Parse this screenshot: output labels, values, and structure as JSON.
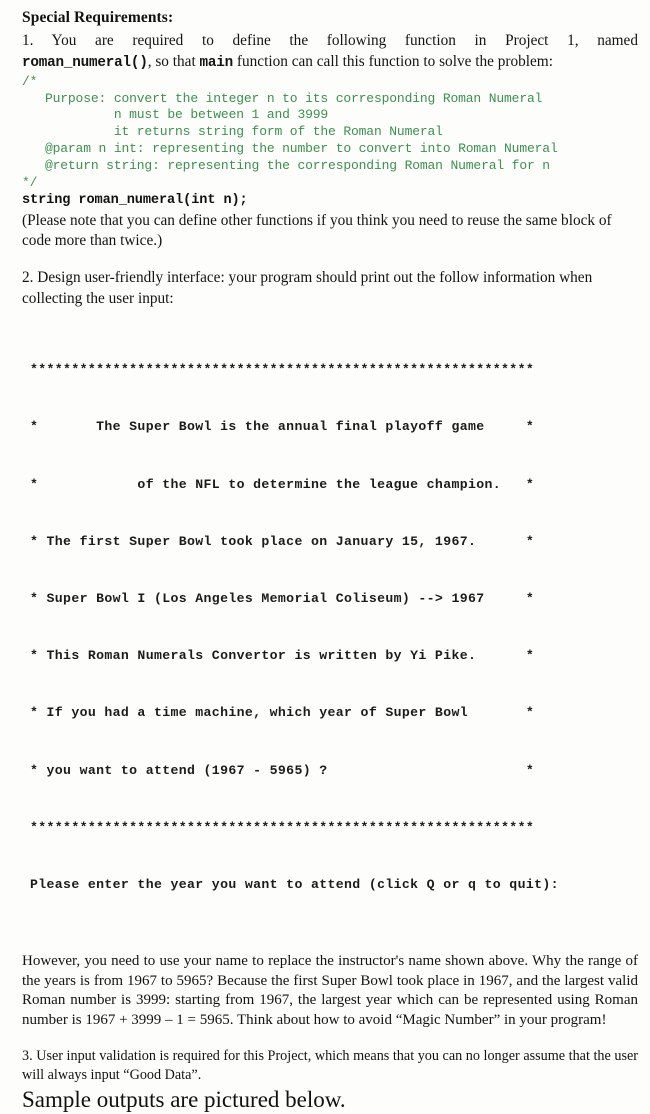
{
  "document": {
    "heading": "Special Requirements:",
    "req1": {
      "text_before": "1. You are required to define the following function in Project 1, named",
      "mono1": "roman_numeral()",
      "text_mid": ", so that ",
      "mono2": "main",
      "text_after": " function can call this function to solve the problem:",
      "code_comment": "/*\n   Purpose: convert the integer n to its corresponding Roman Numeral\n            n must be between 1 and 3999\n            it returns string form of the Roman Numeral\n   @param n int: representing the number to convert into Roman Numeral\n   @return string: representing the corresponding Roman Numeral for n\n*/",
      "code_signature": "string roman_numeral(int n);",
      "note": "(Please note that you can define other functions if you think you need to reuse the same block of code more than twice.)"
    },
    "req2": {
      "text": "2. Design user-friendly interface: your program should print out the follow information when collecting the user input:",
      "console_lines": [
        "*************************************************************",
        "*       The Super Bowl is the annual final playoff game     *",
        "*            of the NFL to determine the league champion.   *",
        "* The first Super Bowl took place on January 15, 1967.      *",
        "* Super Bowl I (Los Angeles Memorial Coliseum) --> 1967     *",
        "* This Roman Numerals Convertor is written by Yi Pike.      *",
        "* If you had a time machine, which year of Super Bowl       *",
        "* you want to attend (1967 - 5965) ?                        *",
        "*************************************************************",
        "Please enter the year you want to attend (click Q or q to quit):"
      ],
      "explanation": "However, you need to use your name to replace the instructor's name shown above. Why the range of the years is from 1967 to 5965? Because the first Super Bowl took place in 1967, and the largest valid Roman number is 3999: starting from 1967, the largest year which can be represented using Roman number is 1967 + 3999 – 1 = 5965. Think about how to avoid “Magic Number” in your program!"
    },
    "req3": {
      "text": "3. User input validation is required for this Project, which means that you can no longer assume that the user will always input “Good Data”."
    },
    "closing": "Sample outputs are pictured below.",
    "colors": {
      "code_green": "#3f8f52",
      "body_text": "#141414",
      "page_background": "#fdfdfb"
    }
  }
}
